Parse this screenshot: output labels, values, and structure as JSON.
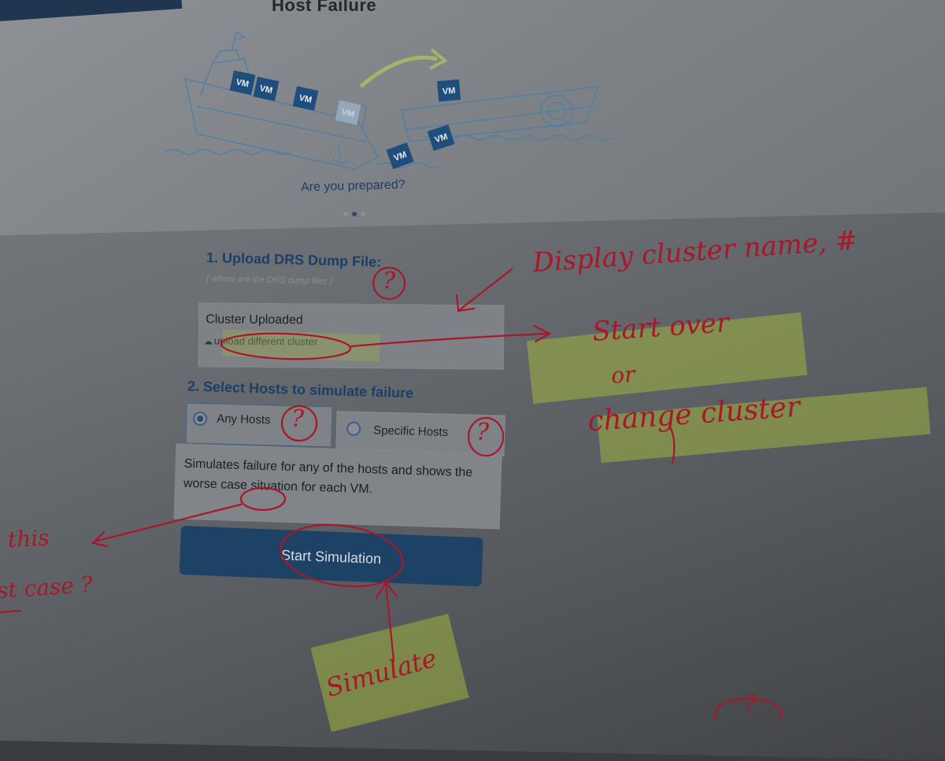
{
  "header": {
    "title": "Host Failure"
  },
  "carousel": {
    "vm_label": "VM",
    "caption": "Are you prepared?",
    "dot_count": 3,
    "active_dot": 2
  },
  "step1": {
    "title": "1. Upload DRS Dump File:",
    "help_link": "( where are the DRS dump files )",
    "upload_status": "Cluster Uploaded",
    "reupload_link": "upload different cluster"
  },
  "step2": {
    "title": "2. Select Hosts to simulate failure",
    "options": [
      {
        "label": "Any Hosts",
        "selected": true
      },
      {
        "label": "Specific Hosts",
        "selected": false
      }
    ],
    "description": "Simulates failure for any of the hosts and shows the worse case situation for each VM."
  },
  "actions": {
    "start_label": "Start Simulation"
  },
  "annotations": {
    "display_note": "Display cluster name, #",
    "start_over": "Start over",
    "or": "or",
    "change_cluster": "change cluster",
    "this": "this",
    "worst_case": "st case ?",
    "simulate": "Simulate",
    "question_mark": "?"
  },
  "colors": {
    "ink": "#a8172a",
    "highlighter": "#a0b240",
    "brand_blue": "#1d4266"
  }
}
